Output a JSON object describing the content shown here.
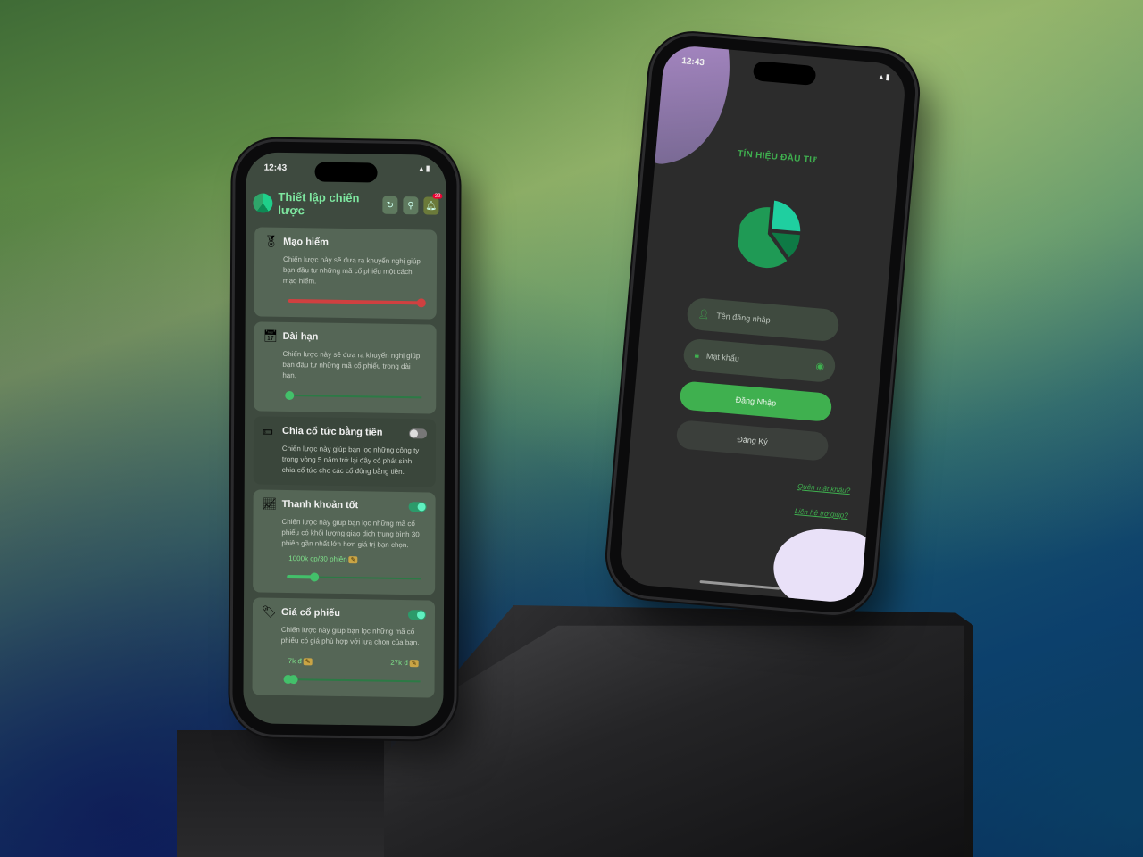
{
  "left_phone": {
    "status_time": "12:43",
    "header": {
      "title": "Thiết lập chiến lược",
      "notification_count": "22"
    },
    "cards": [
      {
        "icon": "medal-icon",
        "title": "Mạo hiểm",
        "description": "Chiến lược này sẽ đưa ra khuyến nghị giúp bạn đầu tư những mã cổ phiếu một cách mạo hiểm.",
        "slider_value": 1.0
      },
      {
        "icon": "calendar-icon",
        "title": "Dài hạn",
        "description": "Chiến lược này sẽ đưa ra khuyến nghị giúp bạn đầu tư những mã cổ phiếu trong dài hạn.",
        "slider_value": 0.0
      },
      {
        "icon": "money-icon",
        "title": "Chia cổ tức bằng tiền",
        "description": "Chiến lược này giúp bạn lọc những công ty trong vòng 5 năm trở lại đây có phát sinh chia cổ tức cho các cổ đông bằng tiền.",
        "toggle_on": false
      },
      {
        "icon": "chart-icon",
        "title": "Thanh khoản tốt",
        "description": "Chiến lược này giúp bạn lọc những mã cổ phiếu có khối lượng giao dịch trung bình 30 phiên gần nhất lớn hơn giá trị bạn chọn.",
        "toggle_on": true,
        "value_label": "1000k cp/30 phiên",
        "slider_value": 0.2
      },
      {
        "icon": "price-tag-icon",
        "title": "Giá cổ phiếu",
        "description": "Chiến lược này giúp bạn lọc những mã cổ phiếu có giá phù hợp với lựa chọn của bạn.",
        "toggle_on": true,
        "min_label": "7k đ",
        "max_label": "27k đ"
      }
    ]
  },
  "right_phone": {
    "status_time": "12:43",
    "brand": "TÍN HIỆU ĐẦU TƯ",
    "username_placeholder": "Tên đăng nhập",
    "password_placeholder": "Mật khẩu",
    "login_label": "Đăng Nhập",
    "register_label": "Đăng Ký",
    "forgot_label": "Quên mật khẩu?",
    "help_label": "Liên hệ trợ giúp?"
  },
  "colors": {
    "accent_green": "#3fb04f",
    "risk_red": "#d04040",
    "title_green": "#7ee7a0"
  }
}
